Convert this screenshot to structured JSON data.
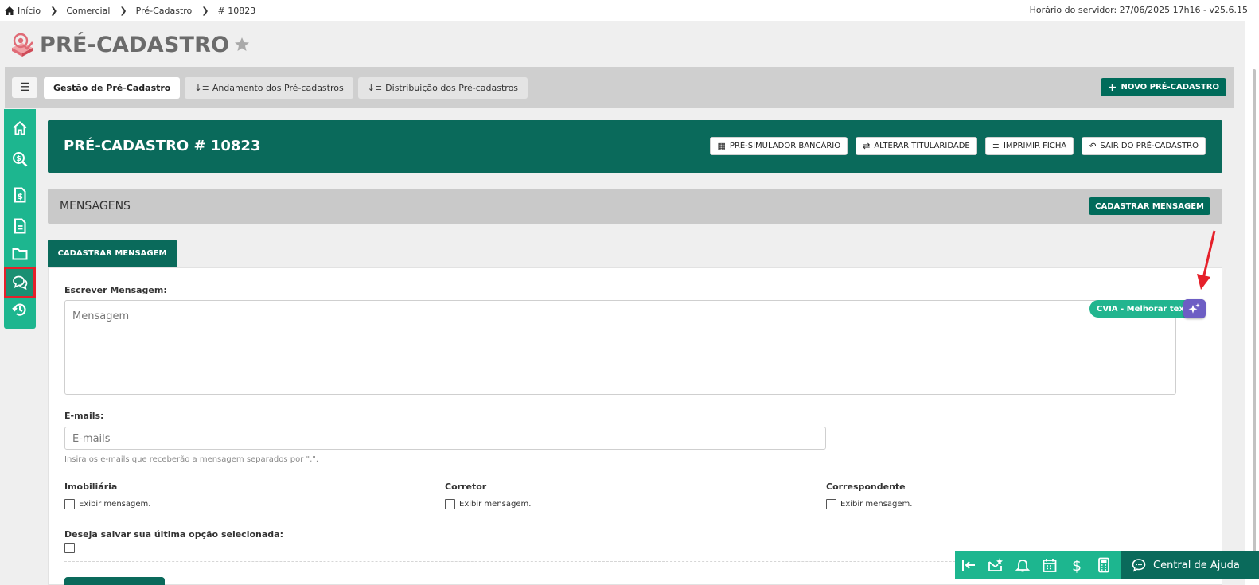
{
  "breadcrumbs": [
    {
      "label": "Início",
      "icon": "home-icon"
    },
    {
      "label": "Comercial"
    },
    {
      "label": "Pré-Cadastro"
    },
    {
      "label": "# 10823"
    }
  ],
  "server_time": "Horário do servidor: 27/06/2025 17h16 - v25.6.15",
  "page_title": "PRÉ-CADASTRO",
  "tabs": [
    {
      "label": "Gestão de Pré-Cadastro",
      "active": true
    },
    {
      "label": "Andamento dos Pré-cadastros",
      "active": false
    },
    {
      "label": "Distribuição dos Pré-cadastros",
      "active": false
    }
  ],
  "new_button": "NOVO PRÉ-CADASTRO",
  "sidebar_icons": [
    "home-icon",
    "search-money-icon",
    "invoice-icon",
    "document-icon",
    "folder-icon",
    "messages-icon",
    "history-icon"
  ],
  "record": {
    "title": "PRÉ-CADASTRO # 10823",
    "actions": [
      {
        "label": "PRÉ-SIMULADOR BANCÁRIO",
        "icon": "calculator-icon"
      },
      {
        "label": "ALTERAR TITULARIDADE",
        "icon": "swap-icon"
      },
      {
        "label": "IMPRIMIR FICHA",
        "icon": "list-icon"
      },
      {
        "label": "SAIR DO PRÉ-CADASTRO",
        "icon": "reply-icon"
      }
    ]
  },
  "section": {
    "title": "MENSAGENS",
    "button": "CADASTRAR MENSAGEM"
  },
  "form_tab": "CADASTRAR MENSAGEM",
  "form": {
    "message_label": "Escrever Mensagem:",
    "message_placeholder": "Mensagem",
    "emails_label": "E-mails:",
    "emails_placeholder": "E-mails",
    "emails_hint": "Insira os e-mails que receberão a mensagem separados por \",\".",
    "groups": [
      {
        "label": "Imobiliária",
        "checkbox": "Exibir mensagem."
      },
      {
        "label": "Corretor",
        "checkbox": "Exibir mensagem."
      },
      {
        "label": "Correspondente",
        "checkbox": "Exibir mensagem."
      }
    ],
    "save_option_label": "Deseja salvar sua última opção selecionada:"
  },
  "cvia_tooltip": "CVIA - Melhorar texto",
  "bottom_icons": [
    "collapse-left-icon",
    "mail-star-icon",
    "bell-icon",
    "calendar-icon",
    "dollar-icon",
    "calculator-icon"
  ],
  "help_label": "Central de Ajuda",
  "colors": {
    "brand_dark": "#0a6a5b",
    "brand_light": "#1db68f",
    "highlight": "#e5202a",
    "cvia": "#6d5ec4"
  }
}
